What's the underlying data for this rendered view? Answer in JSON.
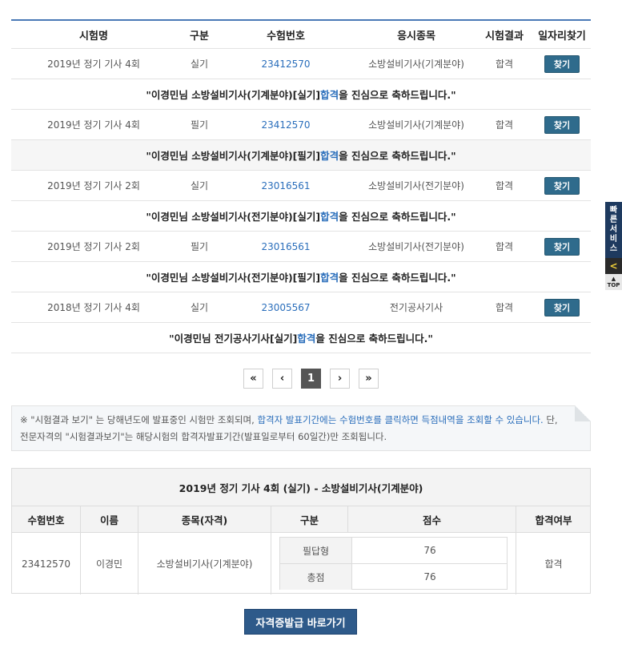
{
  "table": {
    "headers": [
      "시험명",
      "구분",
      "수험번호",
      "응시종목",
      "시험결과",
      "일자리찾기"
    ],
    "rows": [
      {
        "exam": "2019년 정기 기사 4회",
        "type": "실기",
        "number": "23412570",
        "subject": "소방설비기사(기계분야)",
        "result": "합격",
        "button": "찾기",
        "msg_pre": "\"이경민님 소방설비기사(기계분야)[실기] ",
        "msg_hl": "합격",
        "msg_post": "을 진심으로 축하드립니다.\""
      },
      {
        "exam": "2019년 정기 기사 4회",
        "type": "필기",
        "number": "23412570",
        "subject": "소방설비기사(기계분야)",
        "result": "합격",
        "button": "찾기",
        "msg_pre": "\"이경민님 소방설비기사(기계분야)[필기] ",
        "msg_hl": "합격",
        "msg_post": "을 진심으로 축하드립니다.\""
      },
      {
        "exam": "2019년 정기 기사 2회",
        "type": "실기",
        "number": "23016561",
        "subject": "소방설비기사(전기분야)",
        "result": "합격",
        "button": "찾기",
        "msg_pre": "\"이경민님 소방설비기사(전기분야)[실기] ",
        "msg_hl": "합격",
        "msg_post": "을 진심으로 축하드립니다.\""
      },
      {
        "exam": "2019년 정기 기사 2회",
        "type": "필기",
        "number": "23016561",
        "subject": "소방설비기사(전기분야)",
        "result": "합격",
        "button": "찾기",
        "msg_pre": "\"이경민님 소방설비기사(전기분야)[필기] ",
        "msg_hl": "합격",
        "msg_post": "을 진심으로 축하드립니다.\""
      },
      {
        "exam": "2018년 정기 기사 4회",
        "type": "실기",
        "number": "23005567",
        "subject": "전기공사기사",
        "result": "합격",
        "button": "찾기",
        "msg_pre": "\"이경민님 전기공사기사[실기] ",
        "msg_hl": "합격",
        "msg_post": "을 진심으로 축하드립니다.\""
      }
    ]
  },
  "pagination": {
    "first": "«",
    "prev": "‹",
    "current": "1",
    "next": "›",
    "last": "»"
  },
  "notice": {
    "part1": "※ \"시험결과 보기\" 는 당해년도에 발표중인 시험만 조회되며, ",
    "part2": "합격자 발표기간에는 수험번호를 클릭하면 득점내역을 조회할 수 있습니다.",
    "part3": " 단, 전문자격의 \"시험결과보기\"는 해당시험의 합격자발표기간(발표일로부터 60일간)만 조회됩니다."
  },
  "score": {
    "title": "2019년 정기 기사 4회 (실기) - 소방설비기사(기계분야)",
    "headers": [
      "수험번호",
      "이름",
      "종목(자격)",
      "구분",
      "점수",
      "합격여부"
    ],
    "number": "23412570",
    "name": "이경민",
    "subject": "소방설비기사(기계분야)",
    "items": [
      {
        "label": "필답형",
        "value": "76"
      },
      {
        "label": "총점",
        "value": "76"
      }
    ],
    "result": "합격"
  },
  "cert_button": "자격증발급 바로가기",
  "quick_menu": {
    "label": "빠른서비스",
    "arrow": "<",
    "top": "TOP"
  }
}
